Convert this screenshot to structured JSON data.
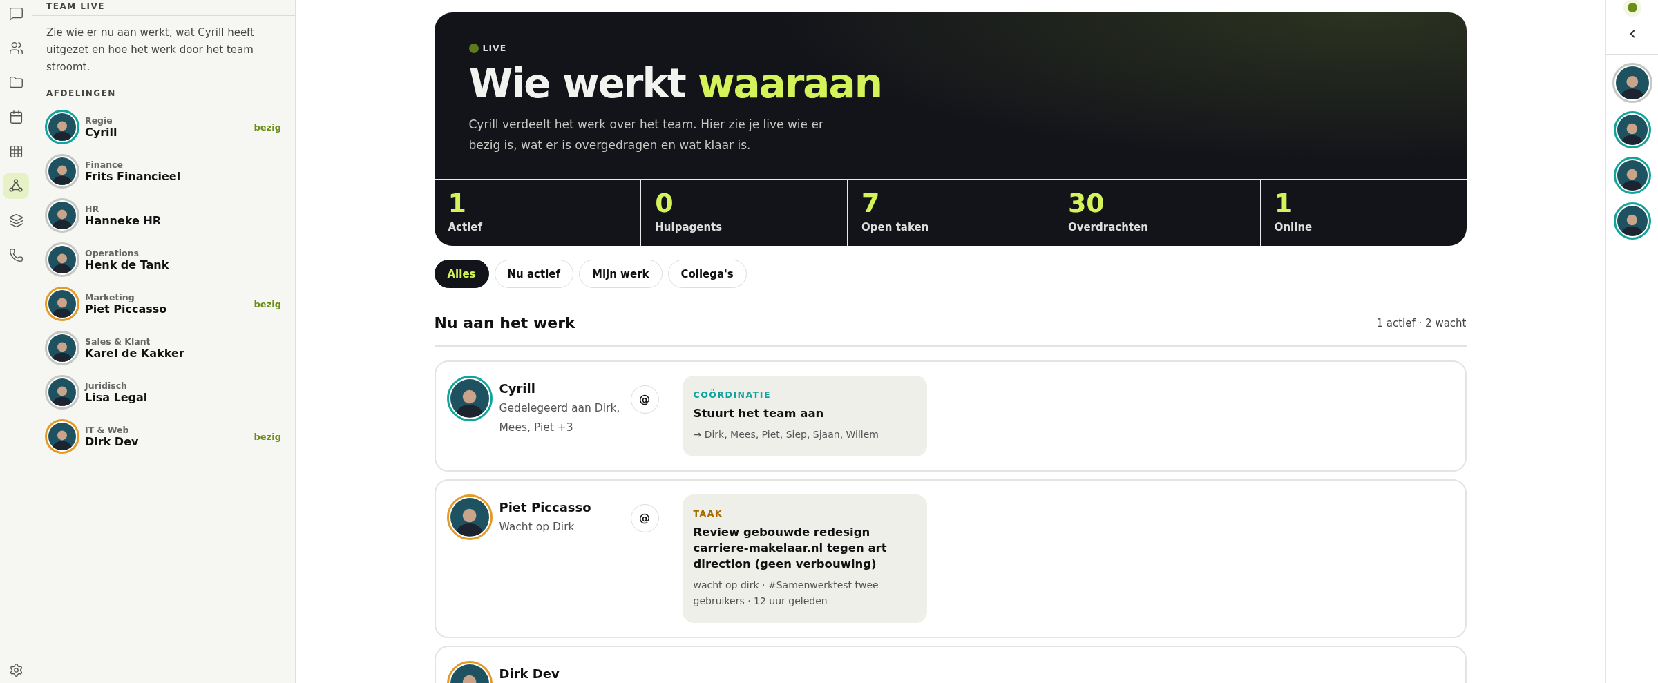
{
  "rail": {
    "items": [
      {
        "kind": "chat",
        "selected": false
      },
      {
        "kind": "people",
        "selected": false
      },
      {
        "kind": "folder",
        "selected": false
      },
      {
        "kind": "calendar",
        "selected": false
      },
      {
        "kind": "grid",
        "selected": false
      },
      {
        "kind": "nodes",
        "selected": true
      },
      {
        "kind": "layers",
        "selected": false
      },
      {
        "kind": "phone",
        "selected": false
      }
    ]
  },
  "sidebar": {
    "title": "TEAM LIVE",
    "intro": "Zie wie er nu aan werkt, wat Cyrill heeft uitgezet en hoe het werk door het team stroomt.",
    "section": "AFDELINGEN",
    "items": [
      {
        "department": "Regie",
        "name": "Cyrill",
        "status": "bezig",
        "color": "#14a39a"
      },
      {
        "department": "Finance",
        "name": "Frits Financieel",
        "color": "#c4c7c2"
      },
      {
        "department": "HR",
        "name": "Hanneke HR",
        "color": "#c4c7c2"
      },
      {
        "department": "Operations",
        "name": "Henk de Tank",
        "color": "#c4c7c2"
      },
      {
        "department": "Marketing",
        "name": "Piet Piccasso",
        "status": "bezig",
        "color": "#e49a26"
      },
      {
        "department": "Sales & Klant",
        "name": "Karel de Kakker",
        "color": "#c4c7c2"
      },
      {
        "department": "Juridisch",
        "name": "Lisa Legal",
        "color": "#c4c7c2"
      },
      {
        "department": "IT & Web",
        "name": "Dirk Dev",
        "status": "bezig",
        "color": "#e49a26"
      }
    ]
  },
  "hero": {
    "badge": "LIVE",
    "title": "Wie werkt **waaraan**",
    "text": "Cyrill verdeelt het werk over het team. Hier zie je live wie er bezig is, wat er is overgedragen en wat klaar is.",
    "stats": [
      {
        "value": "1",
        "label": "Actief"
      },
      {
        "value": "0",
        "label": "Hulpagents"
      },
      {
        "value": "7",
        "label": "Open taken"
      },
      {
        "value": "30",
        "label": "Overdrachten"
      },
      {
        "value": "1",
        "label": "Online"
      }
    ]
  },
  "filters": [
    {
      "label": "Alles",
      "selected": true
    },
    {
      "label": "Nu actief",
      "selected": false
    },
    {
      "label": "Mijn werk",
      "selected": false
    },
    {
      "label": "Collega's",
      "selected": false
    }
  ],
  "section": {
    "title": "Nu aan het werk",
    "summary": "1 actief · 2 wacht"
  },
  "cards": [
    {
      "name": "Cyrill",
      "subtitle": "Gedelegeerd aan Dirk, Mees, Piet +3",
      "mention": "@",
      "color": "#14a39a",
      "task": {
        "kind": "coordination",
        "label": "COÖRDINATIE",
        "title": "Stuurt het team aan",
        "meta": "→ Dirk, Mees, Piet, Siep, Sjaan, Willem"
      }
    },
    {
      "name": "Piet Piccasso",
      "subtitle": "Wacht op Dirk",
      "mention": "@",
      "color": "#e49a26",
      "task": {
        "kind": "task",
        "label": "TAAK",
        "title": "Review gebouwde redesign carriere-makelaar.nl tegen art direction (geen verbouwing)",
        "meta": "wacht op dirk · #Samenwerktest twee gebruikers · 12 uur geleden"
      }
    },
    {
      "name": "Dirk Dev",
      "color": "#e49a26"
    }
  ],
  "right_rail": {
    "avatars": [
      {
        "color": "#c4c7c2"
      },
      {
        "color": "#14a39a"
      },
      {
        "color": "#14a39a"
      },
      {
        "color": "#14a39a"
      }
    ]
  }
}
